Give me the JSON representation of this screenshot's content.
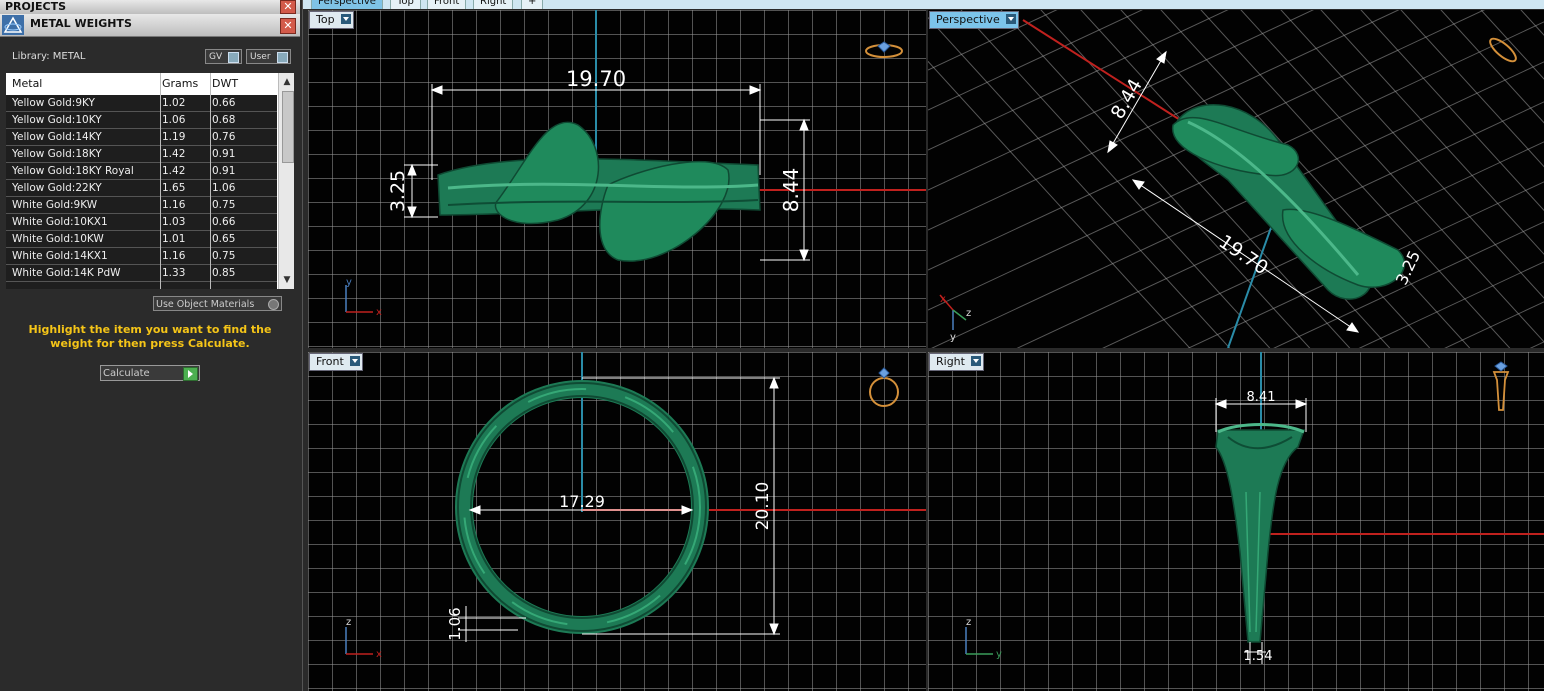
{
  "projects_header": "PROJECTS",
  "panel_title": "METAL WEIGHTS",
  "close_symbol": "✕",
  "library_label": "Library: METAL",
  "toggles": {
    "gv": "GV",
    "user": "User"
  },
  "table": {
    "headers": [
      "Metal",
      "Grams",
      "DWT"
    ],
    "rows": [
      [
        "Yellow Gold:9KY",
        "1.02",
        "0.66"
      ],
      [
        "Yellow Gold:10KY",
        "1.06",
        "0.68"
      ],
      [
        "Yellow Gold:14KY",
        "1.19",
        "0.76"
      ],
      [
        "Yellow Gold:18KY",
        "1.42",
        "0.91"
      ],
      [
        "Yellow Gold:18KY Royal",
        "1.42",
        "0.91"
      ],
      [
        "Yellow Gold:22KY",
        "1.65",
        "1.06"
      ],
      [
        "White Gold:9KW",
        "1.16",
        "0.75"
      ],
      [
        "White Gold:10KX1",
        "1.03",
        "0.66"
      ],
      [
        "White Gold:10KW",
        "1.01",
        "0.65"
      ],
      [
        "White Gold:14KX1",
        "1.16",
        "0.75"
      ],
      [
        "White Gold:14K PdW",
        "1.33",
        "0.85"
      ]
    ]
  },
  "use_object_materials": "Use Object Materials",
  "instructions": "Highlight the item you want to find the weight for then press Calculate.",
  "calculate_label": "Calculate",
  "tabs": [
    "Perspective",
    "Top",
    "Front",
    "Right",
    "+"
  ],
  "viewports": {
    "top": {
      "label": "Top",
      "dims": {
        "width": "19.70",
        "height": "8.44",
        "side": "3.25"
      },
      "axes": {
        "v": "y",
        "h": "x"
      }
    },
    "perspective": {
      "label": "Perspective",
      "dims": {
        "a": "8.44",
        "b": "19.70",
        "c": "3.25"
      },
      "axes": {
        "v": "z",
        "h": "x",
        "d": "y"
      }
    },
    "front": {
      "label": "Front",
      "dims": {
        "diameter": "17.29",
        "height": "20.10",
        "thickness": "1.06"
      },
      "axes": {
        "v": "z",
        "h": "x"
      }
    },
    "right": {
      "label": "Right",
      "dims": {
        "width": "8.41",
        "bottom": "1.54"
      },
      "axes": {
        "v": "z",
        "h": "y"
      }
    }
  },
  "colors": {
    "ring": "#1d7a55",
    "ring_light": "#2e9b6c",
    "axis_red": "#c0211e",
    "axis_blue": "#2a8ca8"
  }
}
